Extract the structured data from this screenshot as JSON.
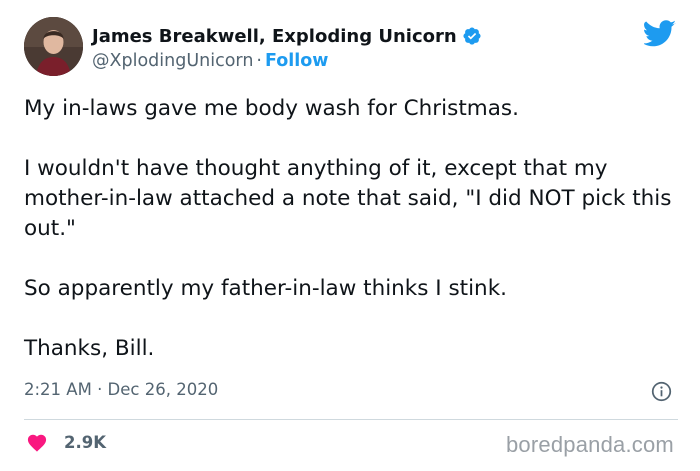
{
  "tweet": {
    "author": {
      "display_name": "James Breakwell, Exploding Unicorn",
      "handle": "@XplodingUnicorn",
      "separator": "·",
      "follow_label": "Follow",
      "verified": true
    },
    "body": {
      "p1": "My in-laws gave me body wash for Christmas.",
      "p2": "I wouldn't have thought anything of it, except that my mother-in-law attached a note that said, \"I did NOT pick this out.\"",
      "p3": "So apparently my father-in-law thinks I stink.",
      "p4": "Thanks, Bill."
    },
    "timestamp": "2:21 AM · Dec 26, 2020",
    "likes": "2.9K"
  },
  "watermark": "boredpanda.com",
  "icons": {
    "logo": "twitter-bird-icon",
    "verified": "verified-badge-icon",
    "info": "info-icon",
    "like": "heart-icon"
  },
  "colors": {
    "text": "#0f1419",
    "secondary_text": "#536471",
    "brand_blue": "#1d9bf0",
    "heart": "#f91880",
    "divider": "#cfd9de"
  }
}
